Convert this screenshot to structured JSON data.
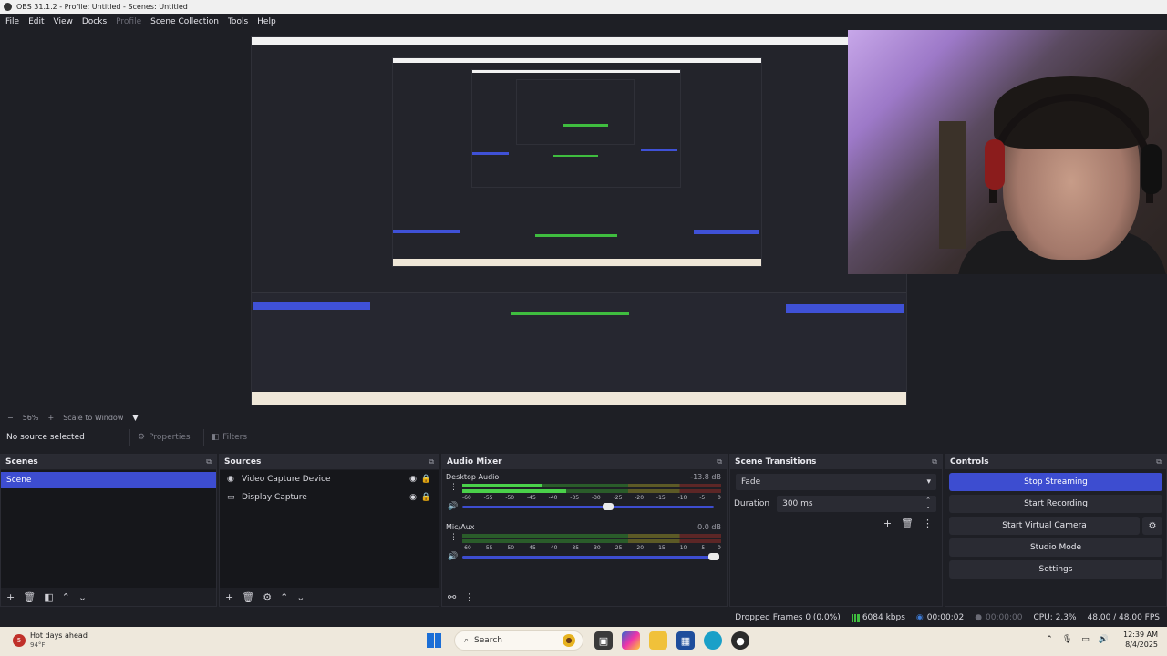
{
  "window": {
    "title": "OBS 31.1.2 - Profile: Untitled - Scenes: Untitled"
  },
  "menu": [
    {
      "label": "File",
      "dim": false
    },
    {
      "label": "Edit",
      "dim": false
    },
    {
      "label": "View",
      "dim": false
    },
    {
      "label": "Docks",
      "dim": false
    },
    {
      "label": "Profile",
      "dim": true
    },
    {
      "label": "Scene Collection",
      "dim": false
    },
    {
      "label": "Tools",
      "dim": false
    },
    {
      "label": "Help",
      "dim": false
    }
  ],
  "preview": {
    "zoom_minus": "−",
    "zoom": "56%",
    "zoom_plus": "+",
    "scale_mode": "Scale to Window",
    "scale_dropdown": "▼"
  },
  "source_toolbar": {
    "no_source": "No source selected",
    "properties": "Properties",
    "filters": "Filters"
  },
  "scenes": {
    "title": "Scenes",
    "items": [
      "Scene"
    ]
  },
  "sources": {
    "title": "Sources",
    "items": [
      {
        "label": "Video Capture Device",
        "icon": "camera-icon"
      },
      {
        "label": "Display Capture",
        "icon": "monitor-icon"
      }
    ]
  },
  "audio_mixer": {
    "title": "Audio Mixer",
    "channels": [
      {
        "name": "Desktop Audio",
        "db": "-13.8 dB",
        "level_a": 0.31,
        "level_b": 0.4,
        "volume": 0.58
      },
      {
        "name": "Mic/Aux",
        "db": "0.0 dB",
        "level_a": 0.0,
        "level_b": 0.0,
        "volume": 1.0
      }
    ],
    "ticks": [
      "-60",
      "-55",
      "-50",
      "-45",
      "-40",
      "-35",
      "-30",
      "-25",
      "-20",
      "-15",
      "-10",
      "-5",
      "0"
    ]
  },
  "transitions": {
    "title": "Scene Transitions",
    "selected": "Fade",
    "duration_label": "Duration",
    "duration_value": "300 ms"
  },
  "controls": {
    "title": "Controls",
    "stop_streaming": "Stop Streaming",
    "start_recording": "Start Recording",
    "start_virtual_camera": "Start Virtual Camera",
    "studio_mode": "Studio Mode",
    "settings": "Settings"
  },
  "status": {
    "dropped_frames": "Dropped Frames 0 (0.0%)",
    "bitrate": "6084 kbps",
    "stream_time": "00:00:02",
    "record_time": "00:00:00",
    "cpu": "CPU: 2.3%",
    "fps": "48.00 / 48.00 FPS"
  },
  "taskbar": {
    "weather_title": "Hot days ahead",
    "weather_temp": "94°F",
    "weather_badge": "5",
    "search": "Search",
    "time": "12:39 AM",
    "date": "8/4/2025"
  },
  "colors": {
    "accent": "#3d4dd0",
    "meter_green": "#4ad14a",
    "background": "#1e1f25"
  }
}
